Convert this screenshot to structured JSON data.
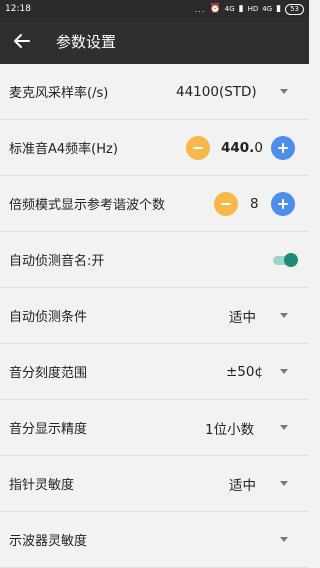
{
  "status_bar": {
    "time": "12:18",
    "indicators": "...",
    "signal_1": "4G",
    "signal_2": "HD",
    "signal_3": "4G",
    "battery": "53"
  },
  "app_bar": {
    "back_icon": "arrow-left-icon",
    "title": "参数设置"
  },
  "settings": [
    {
      "label": "麦克风采样率(/s)",
      "value": "44100(STD)",
      "control": "dropdown"
    },
    {
      "label": "标准音A4频率(Hz)",
      "value_main": "440.",
      "value_decimal": "0",
      "control": "stepper"
    },
    {
      "label": "倍频模式显示参考谐波个数",
      "value": "8",
      "control": "stepper"
    },
    {
      "label": "自动侦测音名:开",
      "control": "toggle",
      "on": true
    },
    {
      "label": "自动侦测条件",
      "value": "适中",
      "control": "dropdown"
    },
    {
      "label": "音分刻度范围",
      "value": "±50¢",
      "control": "dropdown"
    },
    {
      "label": "音分显示精度",
      "value": "1位小数",
      "control": "dropdown"
    },
    {
      "label": "指针灵敏度",
      "value": "适中",
      "control": "dropdown"
    },
    {
      "label": "示波器灵敏度",
      "control": "dropdown"
    }
  ],
  "colors": {
    "minus_button": "#f6b84a",
    "plus_button": "#4c8ee8",
    "toggle_on": "#1d8a73",
    "app_bar": "#2f2f2f"
  }
}
